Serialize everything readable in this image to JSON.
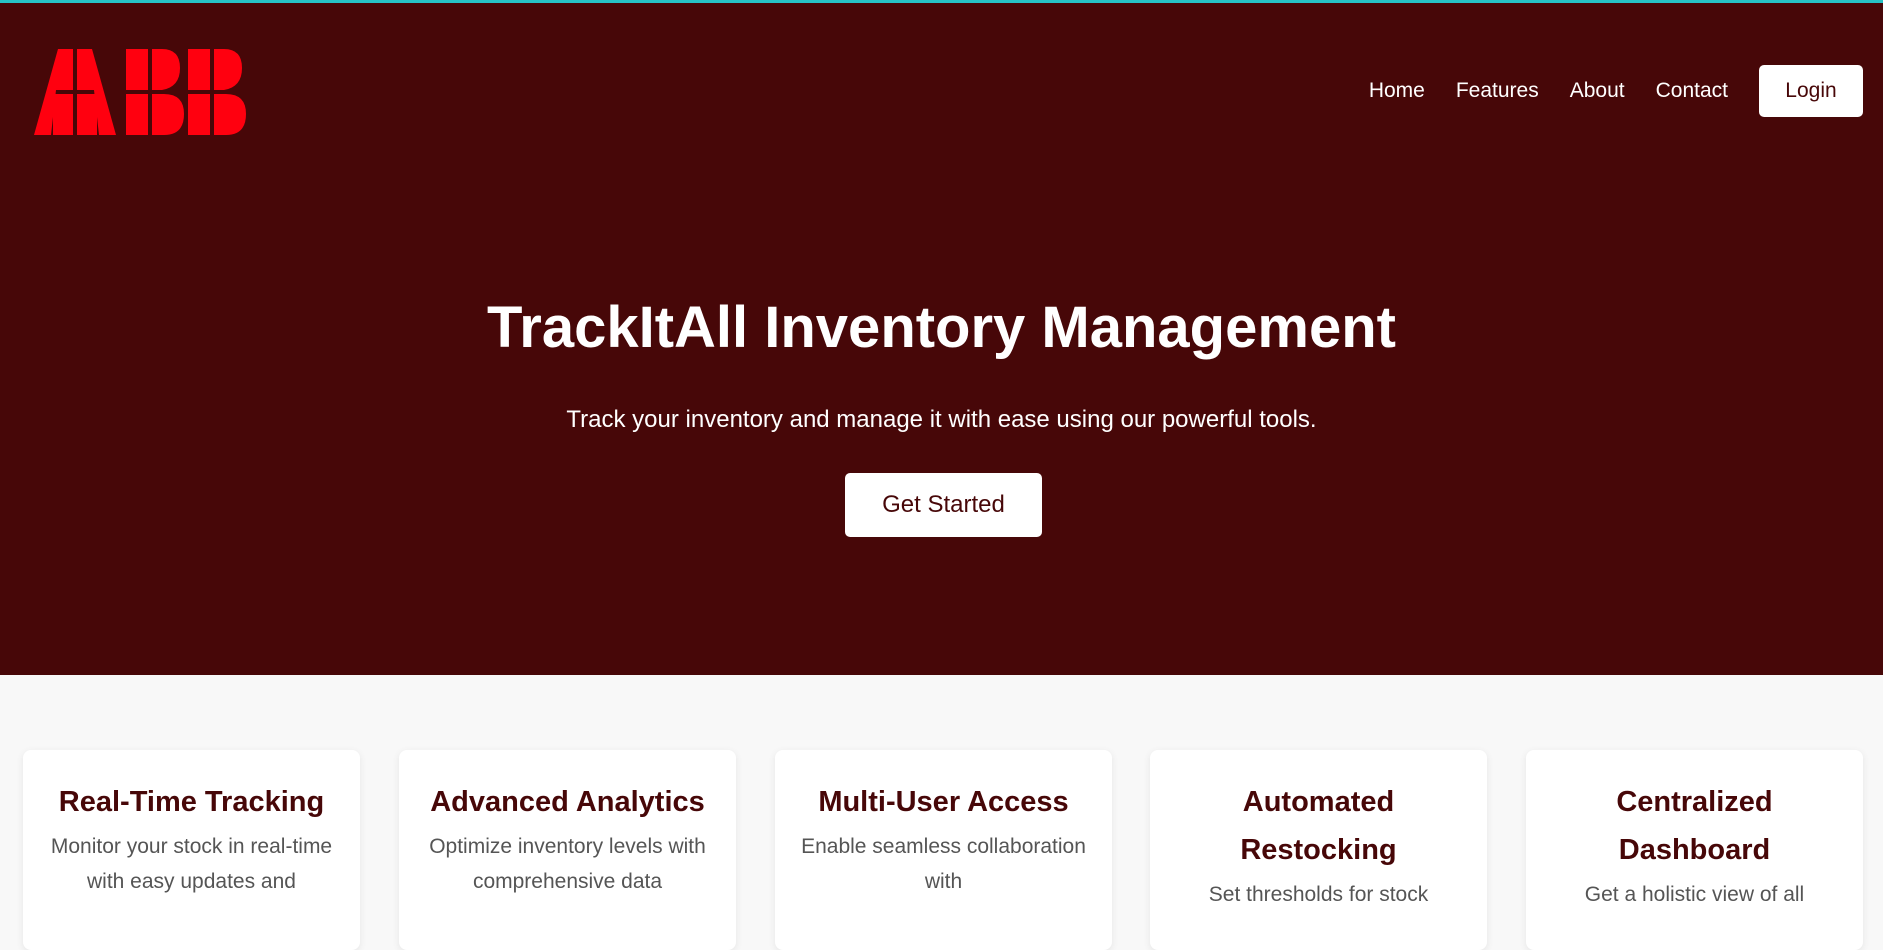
{
  "colors": {
    "hero_bg": "#470708",
    "accent": "#27c2c6",
    "logo_red": "#ff000f",
    "page_bg": "#f8f8f8"
  },
  "brand": {
    "logo_text": "ABB"
  },
  "nav": {
    "links": [
      "Home",
      "Features",
      "About",
      "Contact"
    ],
    "login_label": "Login"
  },
  "hero": {
    "title": "TrackItAll Inventory Management",
    "subtitle": "Track your inventory and manage it with ease using our powerful tools.",
    "cta_label": "Get Started"
  },
  "features": [
    {
      "title": "Real-Time Tracking",
      "text": "Monitor your stock in real-time with easy updates and"
    },
    {
      "title": "Advanced Analytics",
      "text": "Optimize inventory levels with comprehensive data"
    },
    {
      "title": "Multi-User Access",
      "text": "Enable seamless collaboration with"
    },
    {
      "title": "Automated Restocking",
      "text": "Set thresholds for stock"
    },
    {
      "title": "Centralized Dashboard",
      "text": "Get a holistic view of all"
    }
  ]
}
